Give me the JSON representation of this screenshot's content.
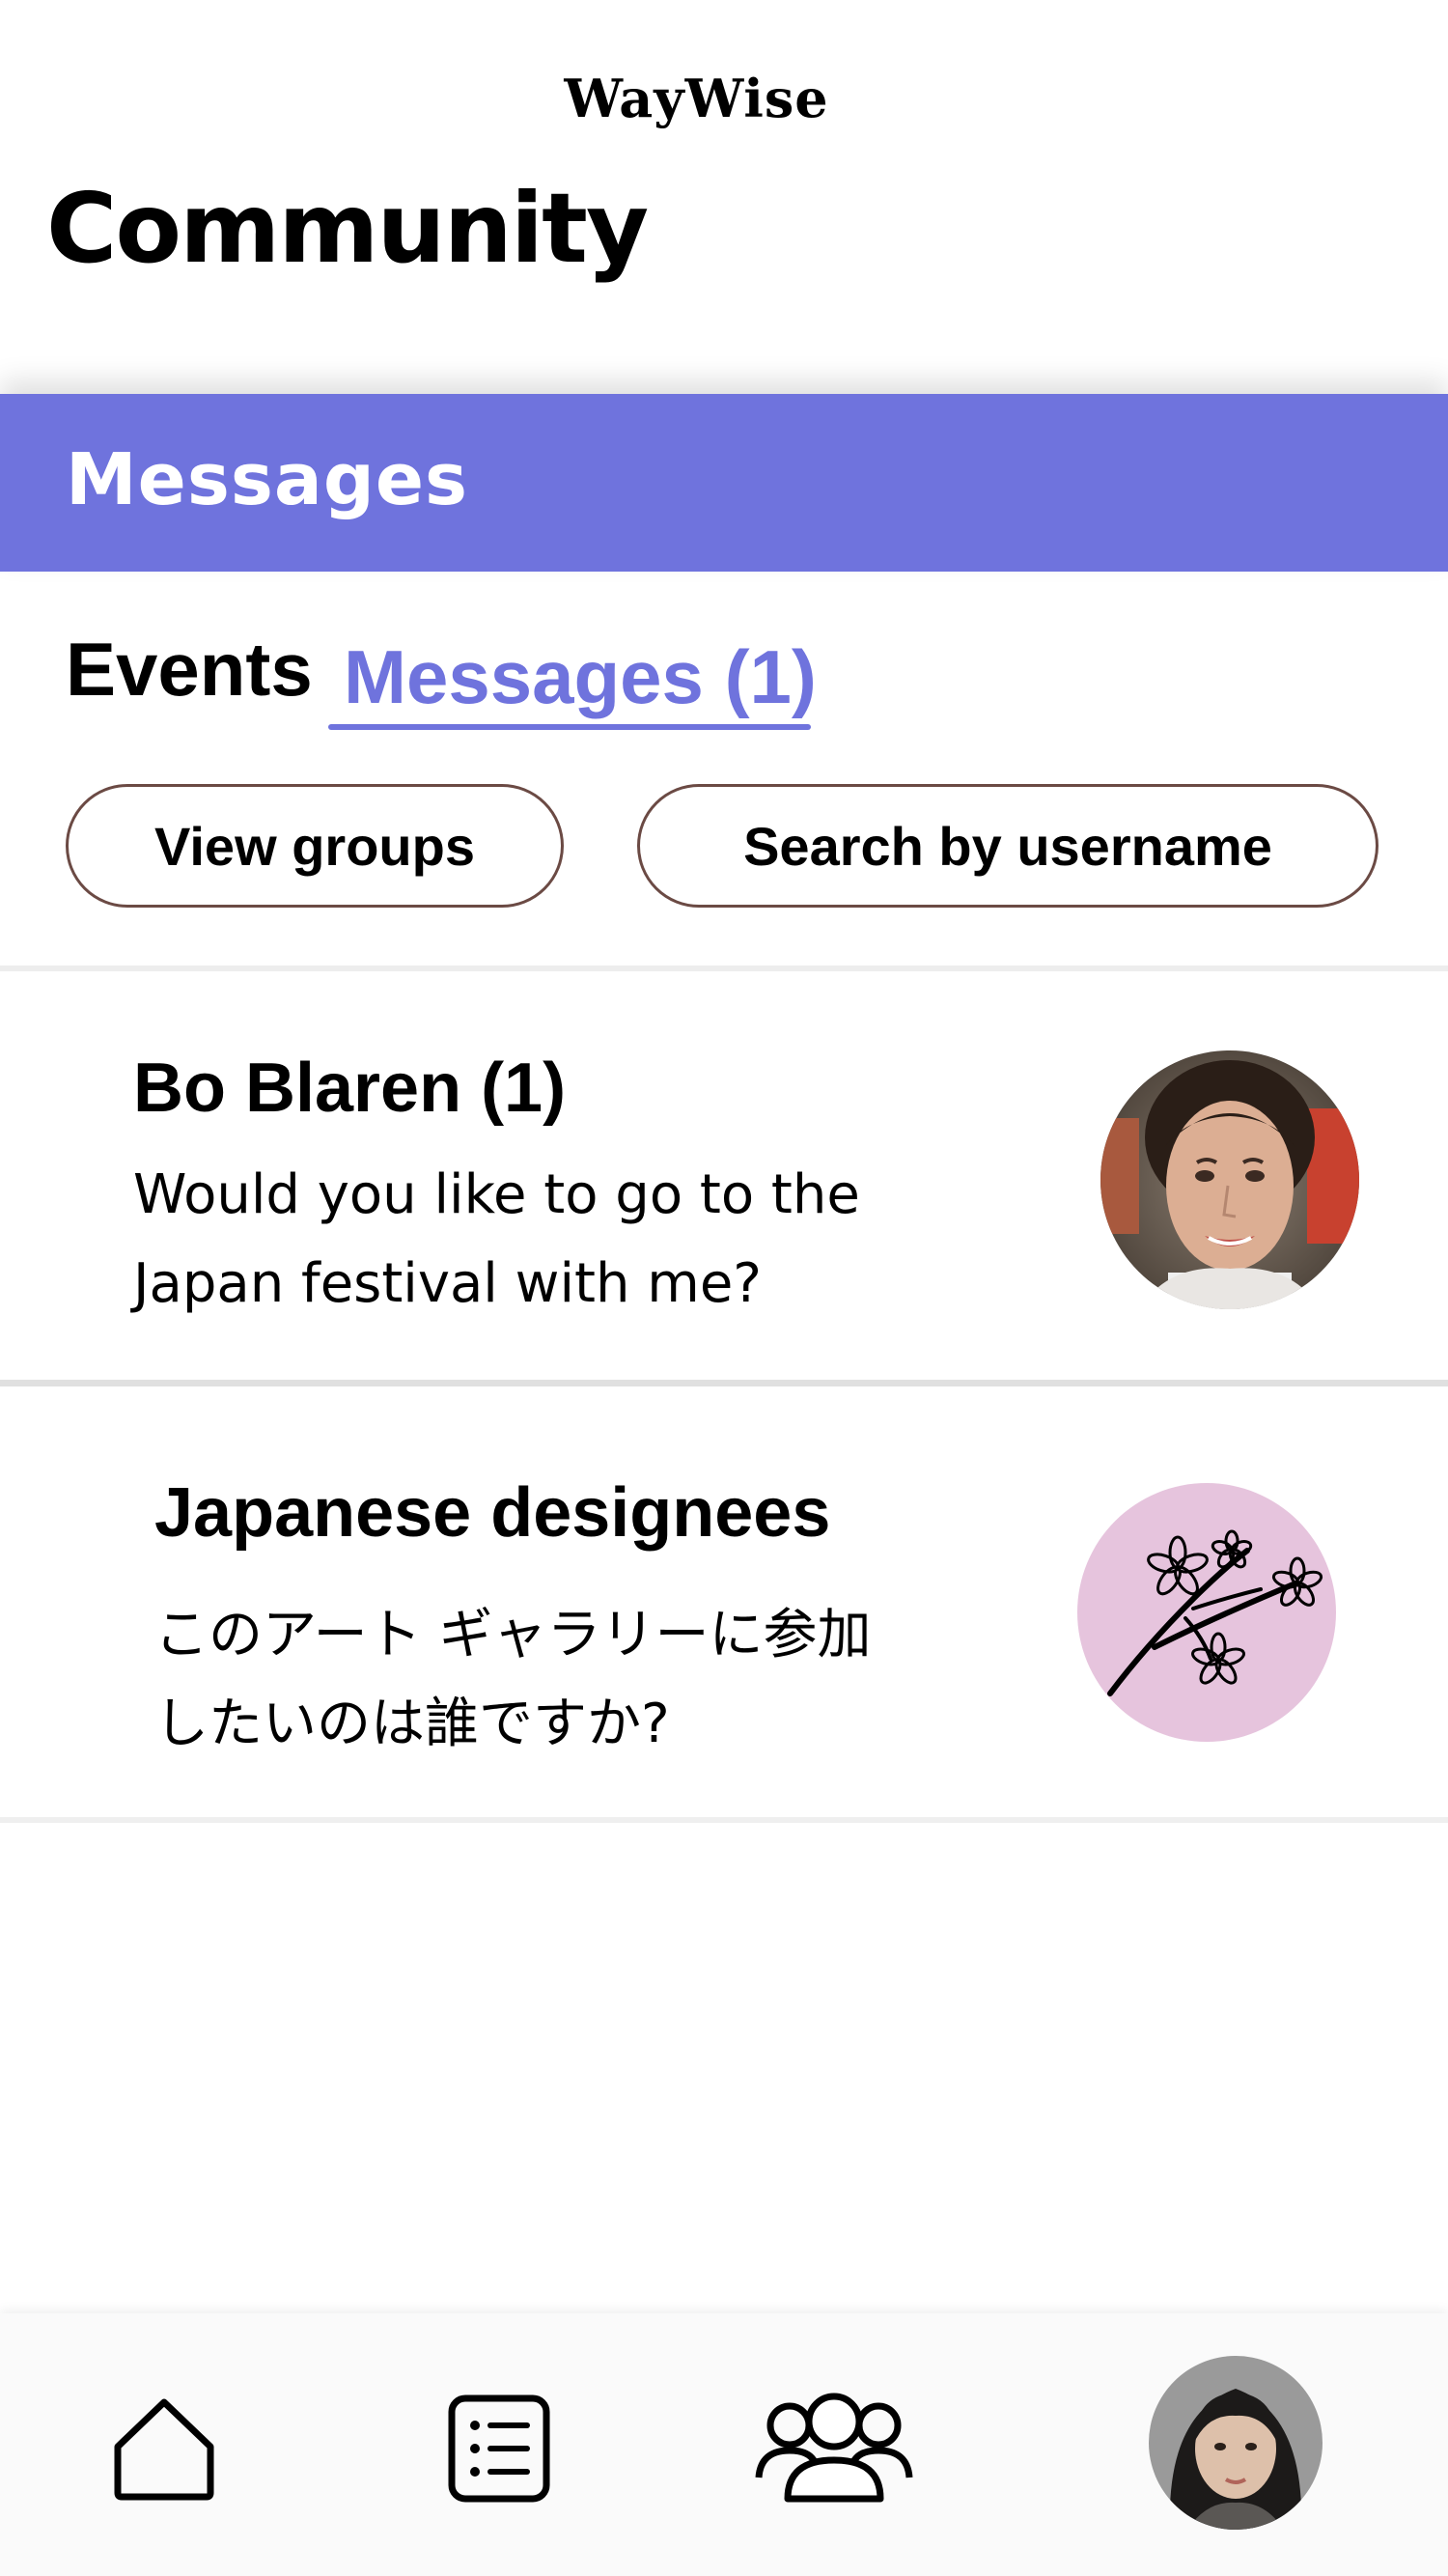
{
  "header": {
    "logo": "WayWise",
    "title": "Community"
  },
  "section_bar": {
    "title": "Messages",
    "color": "#6f73dd"
  },
  "tabs": [
    {
      "label": "Events",
      "active": false
    },
    {
      "label": "Messages (1)",
      "active": true
    }
  ],
  "actions": {
    "view_groups": "View groups",
    "search_username": "Search by username"
  },
  "conversations": [
    {
      "name": "Bo Blaren (1)",
      "preview": "Would you like to go to the Japan festival with me?",
      "avatar": "user-photo"
    },
    {
      "name": "Japanese designees",
      "preview": "このアート ギャラリーに参加したいのは誰ですか?",
      "avatar": "cherry-blossom-icon"
    }
  ],
  "bottom_nav": {
    "items": [
      "home-icon",
      "list-icon",
      "community-icon",
      "profile-avatar"
    ],
    "active": "community-icon"
  }
}
